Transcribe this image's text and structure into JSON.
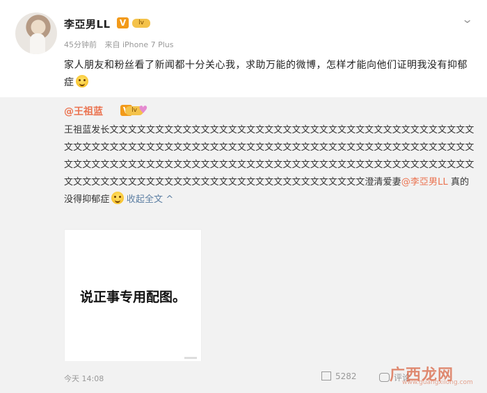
{
  "post": {
    "username": "李亞男LL",
    "verified_badge": "V",
    "level_badge": "lv",
    "menu_icon": "chevron-down-icon",
    "time_ago": "45分钟前",
    "source": "来自 iPhone 7 Plus",
    "text": "家人朋友和粉丝看了新闻都十分关心我，求助万能的微博，怎样才能向他们证明我没有抑郁症"
  },
  "repost": {
    "username": "@王祖蓝",
    "verified_badge": "V",
    "level_badge": "lv",
    "heart_icon": "heart-icon",
    "text_prefix": "王祖蓝发长文",
    "text_body": "文文文文文文文文文文文文文文文文文文文文文文文文文文文文文文文文文文文文文文文文文文文文文文文文文文文文文文文文文文文文文文文文文文文文文文文文文文文文文文文文文文文文文文文文文文文文文文文文文文文文文文文文文文文文文文文文文文文文文文文文文文文文文文文文文文文文文文文文文文文文文文文文文文文文文文文文文文文文文文文文文文",
    "text_suffix": "澄清爱妻",
    "mention": "@李亞男LL",
    "text_end": " 真的没得抑郁症",
    "collapse_label": "收起全文 ^",
    "image_caption": "说正事专用配图。"
  },
  "footer": {
    "timestamp": "今天 14:08",
    "repost_count": "5282",
    "comment_label": "评论"
  },
  "watermark": {
    "text": "广西龙网",
    "subtext": "www.guangxilong.com"
  },
  "colors": {
    "mention": "#eb7350",
    "link": "#5d7fa3",
    "badge": "#f29a1a"
  }
}
